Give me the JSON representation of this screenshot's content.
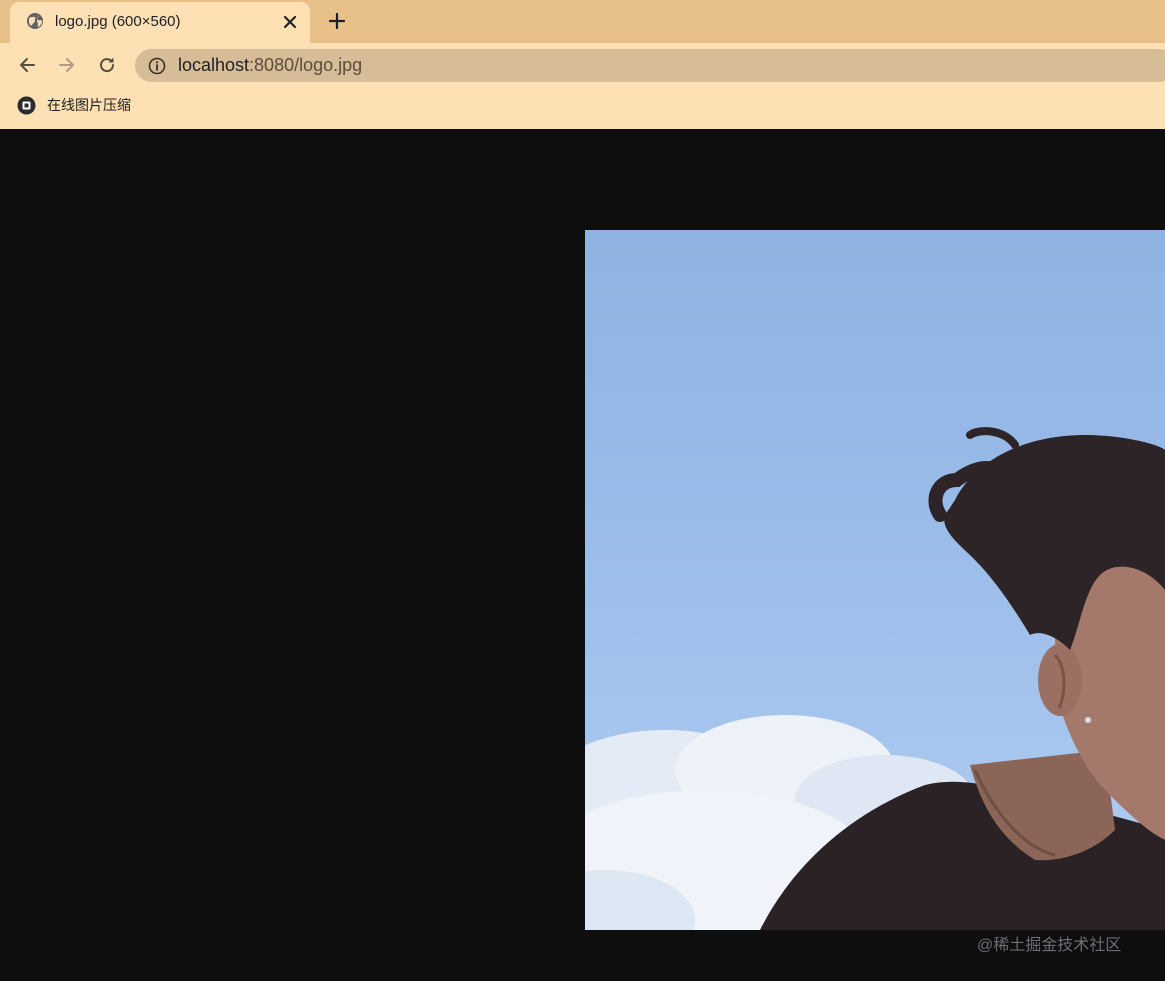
{
  "browser": {
    "tab": {
      "title": "logo.jpg (600×560)",
      "favicon": "globe-icon",
      "close_icon": "close-icon"
    },
    "new_tab_icon": "plus-icon",
    "nav": {
      "back_icon": "back-arrow-icon",
      "forward_icon": "forward-arrow-icon",
      "reload_icon": "reload-icon"
    },
    "address_bar": {
      "info_icon": "info-icon",
      "host": "localhost",
      "rest": ":8080/logo.jpg"
    },
    "bookmarks": [
      {
        "label": "在线图片压缩",
        "icon": "bookmark-app-icon"
      }
    ]
  },
  "content": {
    "image_description_icon": "photo-image",
    "watermark": "@稀土掘金技术社区"
  },
  "colors": {
    "toolbar": "#fde0b3",
    "tabstrip": "#e8c08a",
    "omnibox": "#d7bc98",
    "viewer_background": "#0e0e0f"
  }
}
